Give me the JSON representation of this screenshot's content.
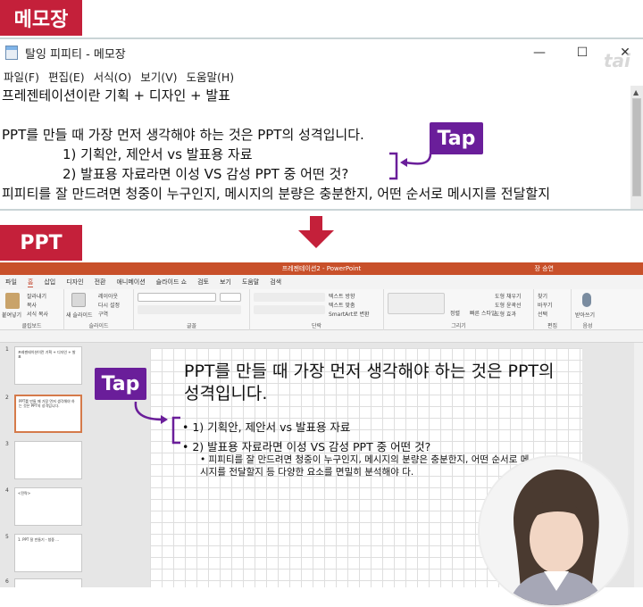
{
  "labels": {
    "notepad_badge": "메모장",
    "ppt_badge": "PPT",
    "tap_1": "Tap",
    "tap_2": "Tap",
    "watermark": "tai"
  },
  "notepad": {
    "title": "탈잉 피피티 - 메모장",
    "menu": [
      "파일(F)",
      "편집(E)",
      "서식(O)",
      "보기(V)",
      "도움말(H)"
    ],
    "lines": [
      "프레젠테이션이란 기획 + 디자인 + 발표",
      "",
      "PPT를 만들 때 가장 먼저 생각해야 하는 것은 PPT의 성격입니다.",
      "1) 기획안, 제안서 vs 발표용 자료",
      "2) 발표용 자료라면 이성 VS 감성 PPT 중 어떤 것?",
      "피피티를 잘 만드려면 청중이 누구인지, 메시지의 분량은 충분한지, 어떤 순서로 메시지를 전달할지"
    ],
    "controls": {
      "minimize": "—",
      "maximize": "☐",
      "close": "✕"
    }
  },
  "ppt": {
    "window_title": "프레젠테이션2 - PowerPoint",
    "user": "장 승연",
    "tabs": [
      "파일",
      "홈",
      "삽입",
      "디자인",
      "전환",
      "애니메이션",
      "슬라이드 쇼",
      "검토",
      "보기",
      "도움말",
      "검색"
    ],
    "active_tab": "홈",
    "ribbon_groups": {
      "clipboard": {
        "label": "클립보드",
        "items": [
          "붙여넣기",
          "잘라내기",
          "복사",
          "서식 복사"
        ]
      },
      "slides": {
        "label": "슬라이드",
        "items": [
          "새 슬라이드",
          "레이아웃",
          "다시 설정",
          "구역"
        ]
      },
      "font": {
        "label": "글꼴"
      },
      "paragraph": {
        "label": "단락",
        "items": [
          "텍스트 방향",
          "텍스트 맞춤",
          "SmartArt로 변환"
        ]
      },
      "drawing": {
        "label": "그리기",
        "items": [
          "정렬",
          "빠른 스타일",
          "도형 채우기",
          "도형 윤곽선",
          "도형 효과"
        ]
      },
      "editing": {
        "label": "편집",
        "items": [
          "찾기",
          "바꾸기",
          "선택"
        ]
      },
      "voice": {
        "label": "음성",
        "items": [
          "받아쓰기"
        ]
      }
    },
    "thumbnails": [
      {
        "num": "1",
        "text": "프레젠테이션이란 기획 + 디자인 + 발표"
      },
      {
        "num": "2",
        "text": "PPT를 만들 때 가장 먼저 생각해야 하는 것은 PPT의 성격입니다."
      },
      {
        "num": "3",
        "text": ""
      },
      {
        "num": "4",
        "text": "<전략>"
      },
      {
        "num": "5",
        "text": "1. PPT 잘 만들기 - 청중 ..."
      },
      {
        "num": "6",
        "text": ""
      }
    ],
    "slide": {
      "title": "PPT를 만들 때 가장 먼저 생각해야 하는 것은 PPT의 성격입니다.",
      "bullets": [
        "• 1) 기획안, 제안서 vs 발표용 자료",
        "• 2) 발표용 자료라면 이성 VS 감성 PPT 중 어떤 것?"
      ],
      "sub_bullet": "• 피피티를 잘 만드려면 청중이 누구인지, 메시지의 분량은 충분한지, 어떤 순서로 메시지를 전달할지 등 다양한 요소를 면밀히 분석해야 다."
    }
  },
  "colors": {
    "badge": "#c4203a",
    "tap": "#6a1e9a",
    "ppt_titlebar": "#c8502a"
  }
}
